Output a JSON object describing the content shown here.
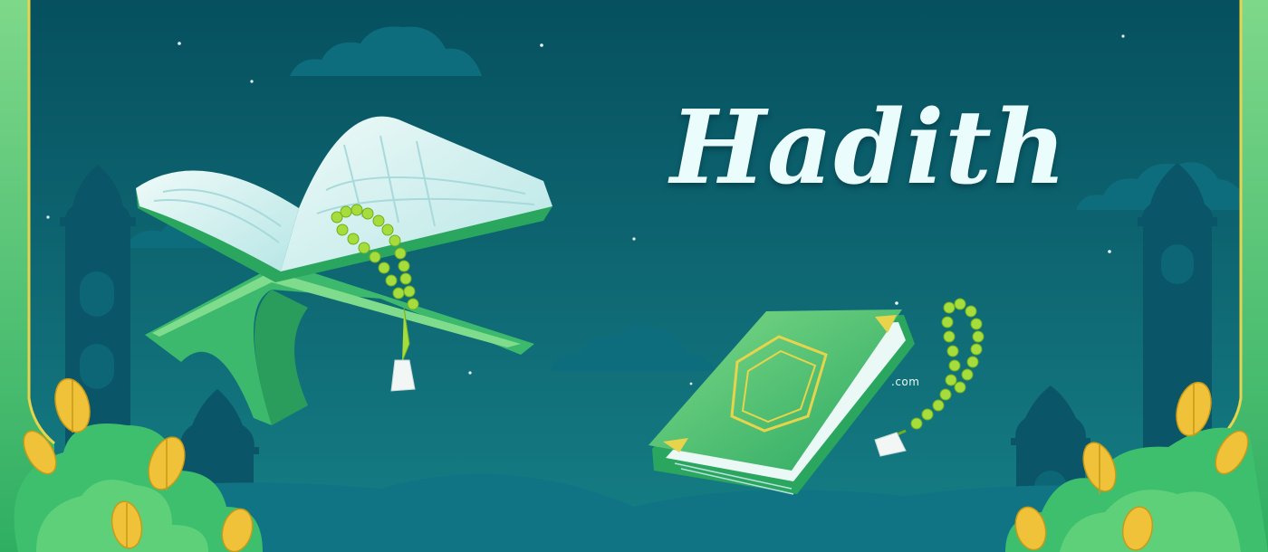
{
  "banner": {
    "title": "Hadith",
    "watermark_text": ".com"
  },
  "colors": {
    "sky_top": "#06505f",
    "sky_bottom": "#167f86",
    "silhouette": "#0a5567",
    "cloud": "#0e6d7d",
    "book_green": "#3fbf76",
    "page_light": "#d9f3f0",
    "bead_green": "#a6dc3c",
    "leaf_gold": "#f0c23a",
    "frame_gold": "#e8d44a",
    "title_color": "#eafcfb"
  },
  "icons": {
    "open_book": "quran-on-rehal-stand-icon",
    "closed_book": "closed-quran-icon",
    "beads": "tasbih-prayer-beads-icon",
    "building": "mosque-minaret-icon",
    "plant": "leafy-bush-icon"
  }
}
